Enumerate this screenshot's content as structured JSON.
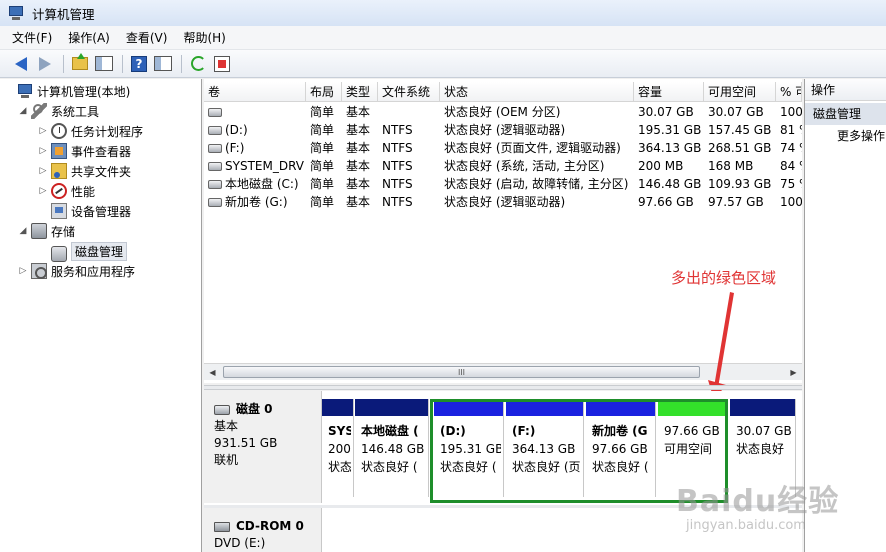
{
  "window": {
    "title": "计算机管理"
  },
  "menu": [
    "文件(F)",
    "操作(A)",
    "查看(V)",
    "帮助(H)"
  ],
  "toolbar": [
    {
      "name": "back-icon"
    },
    {
      "name": "forward-icon"
    },
    {
      "name": "up-folder-icon"
    },
    {
      "name": "show-hide-tree-icon"
    },
    {
      "name": "help-icon",
      "glyph": "?"
    },
    {
      "name": "show-action-pane-icon"
    },
    {
      "name": "refresh-icon"
    },
    {
      "name": "properties-icon"
    }
  ],
  "tree": {
    "root": "计算机管理(本地)",
    "system_tools": "系统工具",
    "task_scheduler": "任务计划程序",
    "event_viewer": "事件查看器",
    "shared_folders": "共享文件夹",
    "performance": "性能",
    "device_manager": "设备管理器",
    "storage": "存储",
    "disk_management": "磁盘管理",
    "services_apps": "服务和应用程序"
  },
  "volume_table": {
    "columns": [
      "卷",
      "布局",
      "类型",
      "文件系统",
      "状态",
      "容量",
      "可用空间",
      "% 可"
    ],
    "rows": [
      {
        "vol": "",
        "layout": "简单",
        "type": "基本",
        "fs": "",
        "status": "状态良好 (OEM 分区)",
        "capacity": "30.07 GB",
        "free": "30.07 GB",
        "pct": "100"
      },
      {
        "vol": "(D:)",
        "layout": "简单",
        "type": "基本",
        "fs": "NTFS",
        "status": "状态良好 (逻辑驱动器)",
        "capacity": "195.31 GB",
        "free": "157.45 GB",
        "pct": "81 %"
      },
      {
        "vol": "(F:)",
        "layout": "简单",
        "type": "基本",
        "fs": "NTFS",
        "status": "状态良好 (页面文件, 逻辑驱动器)",
        "capacity": "364.13 GB",
        "free": "268.51 GB",
        "pct": "74 %"
      },
      {
        "vol": "SYSTEM_DRV",
        "layout": "简单",
        "type": "基本",
        "fs": "NTFS",
        "status": "状态良好 (系统, 活动, 主分区)",
        "capacity": "200 MB",
        "free": "168 MB",
        "pct": "84 %"
      },
      {
        "vol": "本地磁盘 (C:)",
        "layout": "简单",
        "type": "基本",
        "fs": "NTFS",
        "status": "状态良好 (启动, 故障转储, 主分区)",
        "capacity": "146.48 GB",
        "free": "109.93 GB",
        "pct": "75 %"
      },
      {
        "vol": "新加卷 (G:)",
        "layout": "简单",
        "type": "基本",
        "fs": "NTFS",
        "status": "状态良好 (逻辑驱动器)",
        "capacity": "97.66 GB",
        "free": "97.57 GB",
        "pct": "100"
      }
    ],
    "scroll_thumb_glyph": "III"
  },
  "annotation": {
    "text": "多出的绿色区域",
    "color": "#e03434"
  },
  "disks": [
    {
      "name": "磁盘 0",
      "type": "基本",
      "size": "931.51 GB",
      "state": "联机",
      "partitions": [
        {
          "name": "SYS",
          "size": "200",
          "status": "状态",
          "bar": "#0a1a7a"
        },
        {
          "name": "本地磁盘 (",
          "size": "146.48 GB",
          "status": "状态良好 (",
          "bar": "#0a1a7a"
        },
        {
          "name": "(D:)",
          "size": "195.31 GB",
          "status": "状态良好 (",
          "bar": "#1a22e0"
        },
        {
          "name": "(F:)",
          "size": "364.13 GB",
          "status": "状态良好 (页",
          "bar": "#1a22e0"
        },
        {
          "name": "新加卷 (G",
          "size": "97.66 GB",
          "status": "状态良好 (",
          "bar": "#1a22e0"
        },
        {
          "name": "",
          "size": "97.66 GB",
          "status": "可用空间",
          "bar": "#33e02a"
        },
        {
          "name": "",
          "size": "30.07 GB",
          "status": "状态良好",
          "bar": "#0a1a7a"
        }
      ]
    },
    {
      "name": "CD-ROM 0",
      "type": "DVD (E:)"
    }
  ],
  "actions": {
    "title": "操作",
    "section": "磁盘管理",
    "more": "更多操作"
  },
  "watermark": {
    "logo": "Baidu经验",
    "sub": "jingyan.baidu.com"
  },
  "colors": {
    "primary_partition": "#0a1a7a",
    "logical_drive": "#1a22e0",
    "free_space": "#33e02a",
    "highlight_frame": "#1e8e2a"
  }
}
